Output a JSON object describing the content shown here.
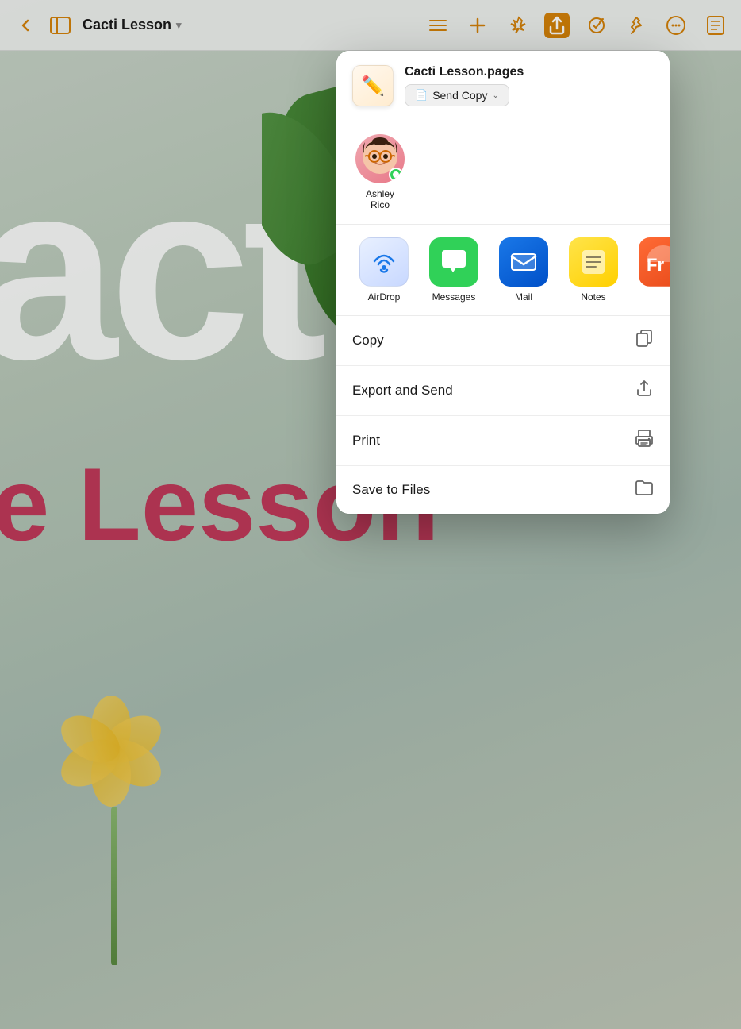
{
  "toolbar": {
    "back_icon": "‹",
    "sidebar_icon": "⊞",
    "title": "Cacti Lesson",
    "chevron": "▾",
    "list_icon": "≡",
    "add_icon": "+",
    "magic_icon": "✦",
    "share_icon": "↑",
    "collab_icon": "↺",
    "pin_icon": "📌",
    "more_icon": "•••",
    "doc_icon": "📄"
  },
  "share_sheet": {
    "file_name": "Cacti Lesson.pages",
    "send_copy_label": "Send Copy",
    "recent_contacts": [
      {
        "name": "Ashley\nRico",
        "avatar_emoji": "🧑",
        "badge_color": "#30d158"
      }
    ],
    "apps": [
      {
        "label": "AirDrop",
        "type": "airdrop"
      },
      {
        "label": "Messages",
        "type": "messages"
      },
      {
        "label": "Mail",
        "type": "mail"
      },
      {
        "label": "Notes",
        "type": "notes"
      },
      {
        "label": "Fr...",
        "type": "fr"
      }
    ],
    "actions": [
      {
        "label": "Copy",
        "icon": "copy"
      },
      {
        "label": "Export and Send",
        "icon": "export"
      },
      {
        "label": "Print",
        "icon": "print"
      },
      {
        "label": "Save to Files",
        "icon": "folder"
      }
    ]
  },
  "document": {
    "bg_text": "acti",
    "lesson_text": "e Lesson"
  }
}
